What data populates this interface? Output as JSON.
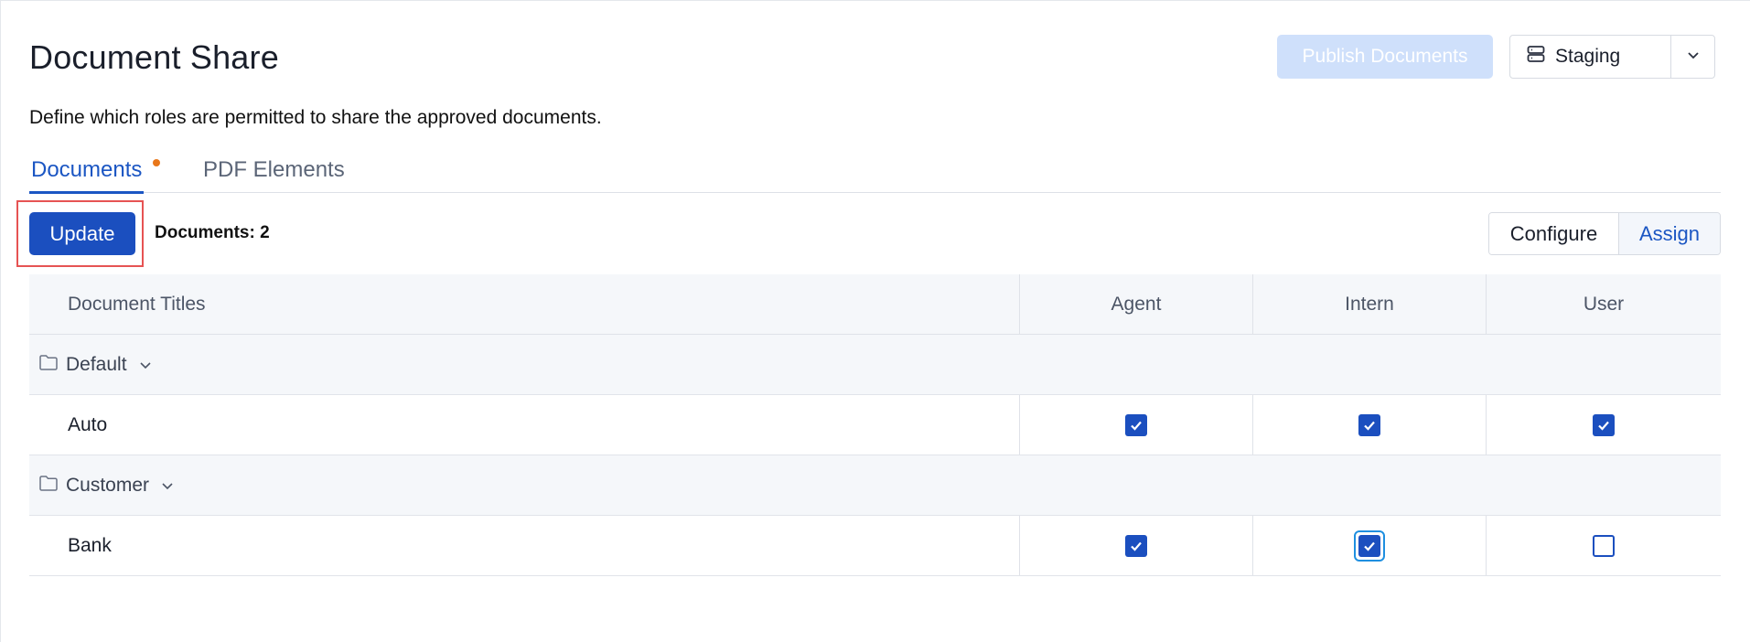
{
  "page": {
    "title": "Document Share",
    "subtitle": "Define which roles are permitted to share the approved documents."
  },
  "header": {
    "publish_label": "Publish Documents",
    "environment": {
      "selected": "Staging",
      "icon": "server-icon"
    }
  },
  "tabs": [
    {
      "label": "Documents",
      "active": true,
      "has_indicator": true
    },
    {
      "label": "PDF Elements",
      "active": false
    }
  ],
  "toolbar": {
    "update_label": "Update",
    "doc_count_label": "Documents:",
    "doc_count_value": "2",
    "view_toggle": {
      "configure_label": "Configure",
      "assign_label": "Assign",
      "selected": "Assign"
    }
  },
  "table": {
    "columns": [
      "Document Titles",
      "Agent",
      "Intern",
      "User"
    ],
    "groups": [
      {
        "name": "Default",
        "documents": [
          {
            "title": "Auto",
            "agent": true,
            "intern": true,
            "user": true
          }
        ]
      },
      {
        "name": "Customer",
        "documents": [
          {
            "title": "Bank",
            "agent": true,
            "intern": true,
            "user": false,
            "focused": "intern"
          }
        ]
      }
    ]
  },
  "colors": {
    "primary": "#1b4fbf",
    "link": "#1b56c3",
    "publish_disabled": "#cfe0fb",
    "tab_indicator": "#e8771a",
    "highlight": "#e65353"
  }
}
